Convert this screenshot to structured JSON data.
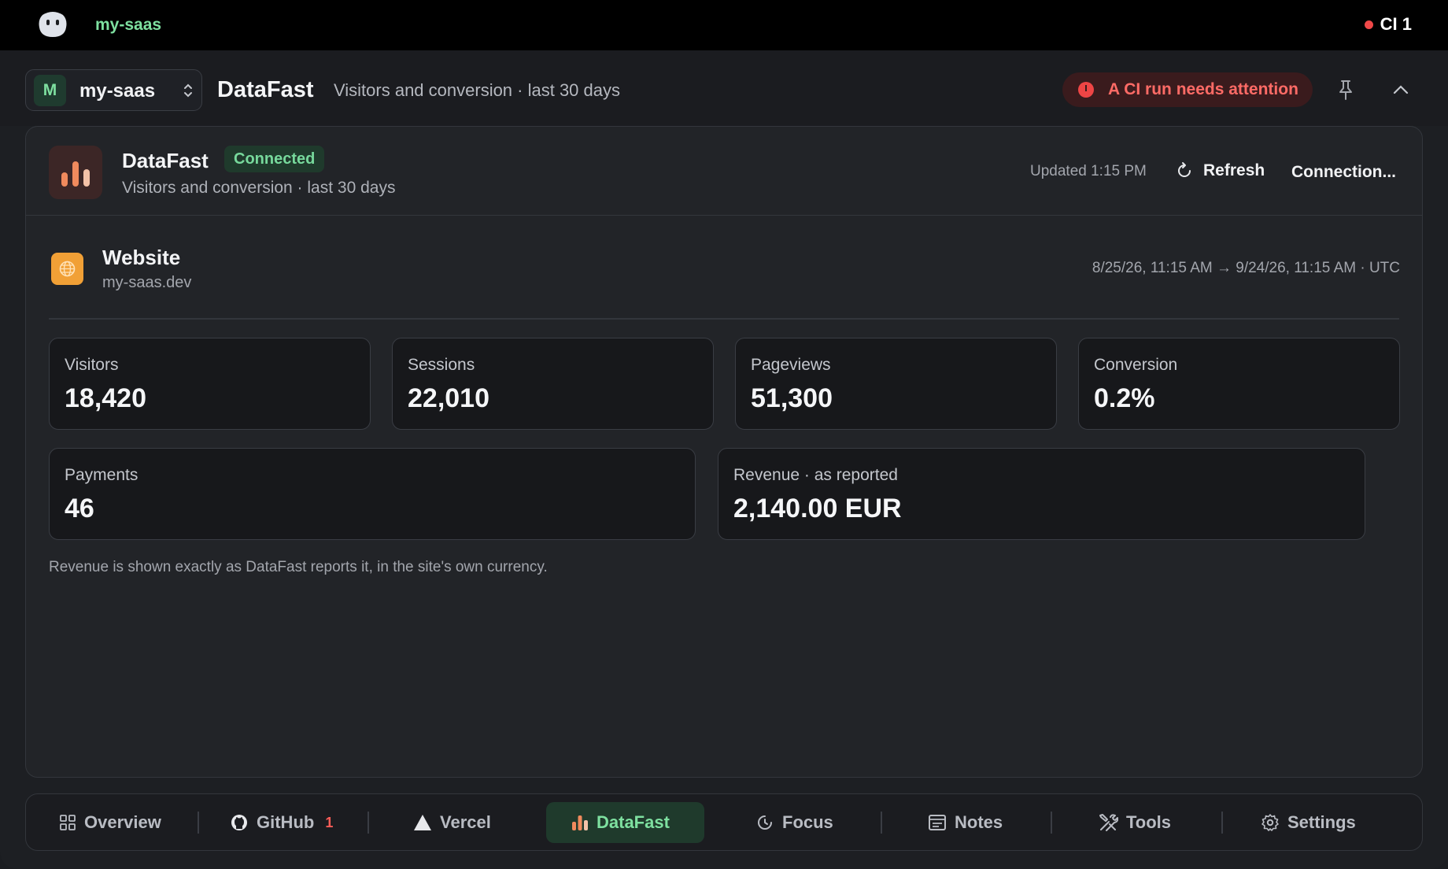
{
  "topbar": {
    "project": "my-saas",
    "ci_label": "CI 1"
  },
  "header": {
    "avatar_letter": "M",
    "project_name": "my-saas",
    "title": "DataFast",
    "subtitle": "Visitors and conversion · last 30 days",
    "alert": "A CI run needs attention"
  },
  "panel": {
    "title": "DataFast",
    "status": "Connected",
    "subtitle": "Visitors and conversion · last 30 days",
    "updated": "Updated 1:15 PM",
    "refresh_label": "Refresh",
    "connection_label": "Connection..."
  },
  "site": {
    "name": "Website",
    "domain": "my-saas.dev",
    "range": "8/25/26, 11:15 AM → 9/24/26, 11:15 AM · UTC"
  },
  "metrics": [
    {
      "label": "Visitors",
      "value": "18,420"
    },
    {
      "label": "Sessions",
      "value": "22,010"
    },
    {
      "label": "Pageviews",
      "value": "51,300"
    },
    {
      "label": "Conversion",
      "value": "0.2%"
    },
    {
      "label": "Payments",
      "value": "46"
    },
    {
      "label": "Revenue · as reported",
      "value": "2,140.00 EUR"
    }
  ],
  "footnote": "Revenue is shown exactly as DataFast reports it, in the site's own currency.",
  "nav": [
    {
      "label": "Overview",
      "icon": "grid-icon"
    },
    {
      "label": "GitHub",
      "icon": "github-icon",
      "badge": "1"
    },
    {
      "label": "Vercel",
      "icon": "vercel-triangle-icon"
    },
    {
      "label": "DataFast",
      "icon": "bar-chart-icon",
      "active": true
    },
    {
      "label": "Focus",
      "icon": "timer-icon"
    },
    {
      "label": "Notes",
      "icon": "notes-icon"
    },
    {
      "label": "Tools",
      "icon": "tools-icon"
    },
    {
      "label": "Settings",
      "icon": "gear-icon"
    }
  ],
  "colors": {
    "accent_green": "#7ee0a0",
    "alert_red": "#ff6b66",
    "datafast_orange": "#f08a5d"
  }
}
